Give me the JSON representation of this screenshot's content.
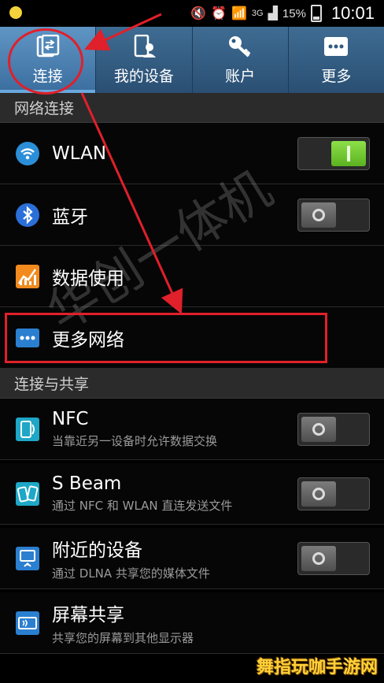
{
  "status_bar": {
    "network": "3G",
    "battery": "15%",
    "time": "10:01"
  },
  "tabs": [
    {
      "label": "连接",
      "icon": "connection-icon",
      "active": true
    },
    {
      "label": "我的设备",
      "icon": "my-device-icon",
      "active": false
    },
    {
      "label": "账户",
      "icon": "key-icon",
      "active": false
    },
    {
      "label": "更多",
      "icon": "more-dots-icon",
      "active": false
    }
  ],
  "sections": {
    "network": "网络连接",
    "share": "连接与共享"
  },
  "rows": {
    "wlan": {
      "title": "WLAN",
      "toggle_on": true
    },
    "bluetooth": {
      "title": "蓝牙",
      "toggle_on": false
    },
    "data_usage": {
      "title": "数据使用"
    },
    "more_networks": {
      "title": "更多网络"
    },
    "nfc": {
      "title": "NFC",
      "subtitle": "当靠近另一设备时允许数据交换",
      "toggle_on": false
    },
    "sbeam": {
      "title": "S Beam",
      "subtitle": "通过 NFC 和 WLAN 直连发送文件",
      "toggle_on": false
    },
    "nearby": {
      "title": "附近的设备",
      "subtitle": "通过 DLNA 共享您的媒体文件",
      "toggle_on": false
    },
    "screen_mirror": {
      "title": "屏幕共享",
      "subtitle": "共享您的屏幕到其他显示器"
    }
  },
  "watermark": "华创一体机",
  "site_watermark": "舞指玩咖手游网",
  "colors": {
    "annotation": "#e0202a",
    "tab_bar": "#2f5a80",
    "toggle_on": "#6cc82c"
  }
}
